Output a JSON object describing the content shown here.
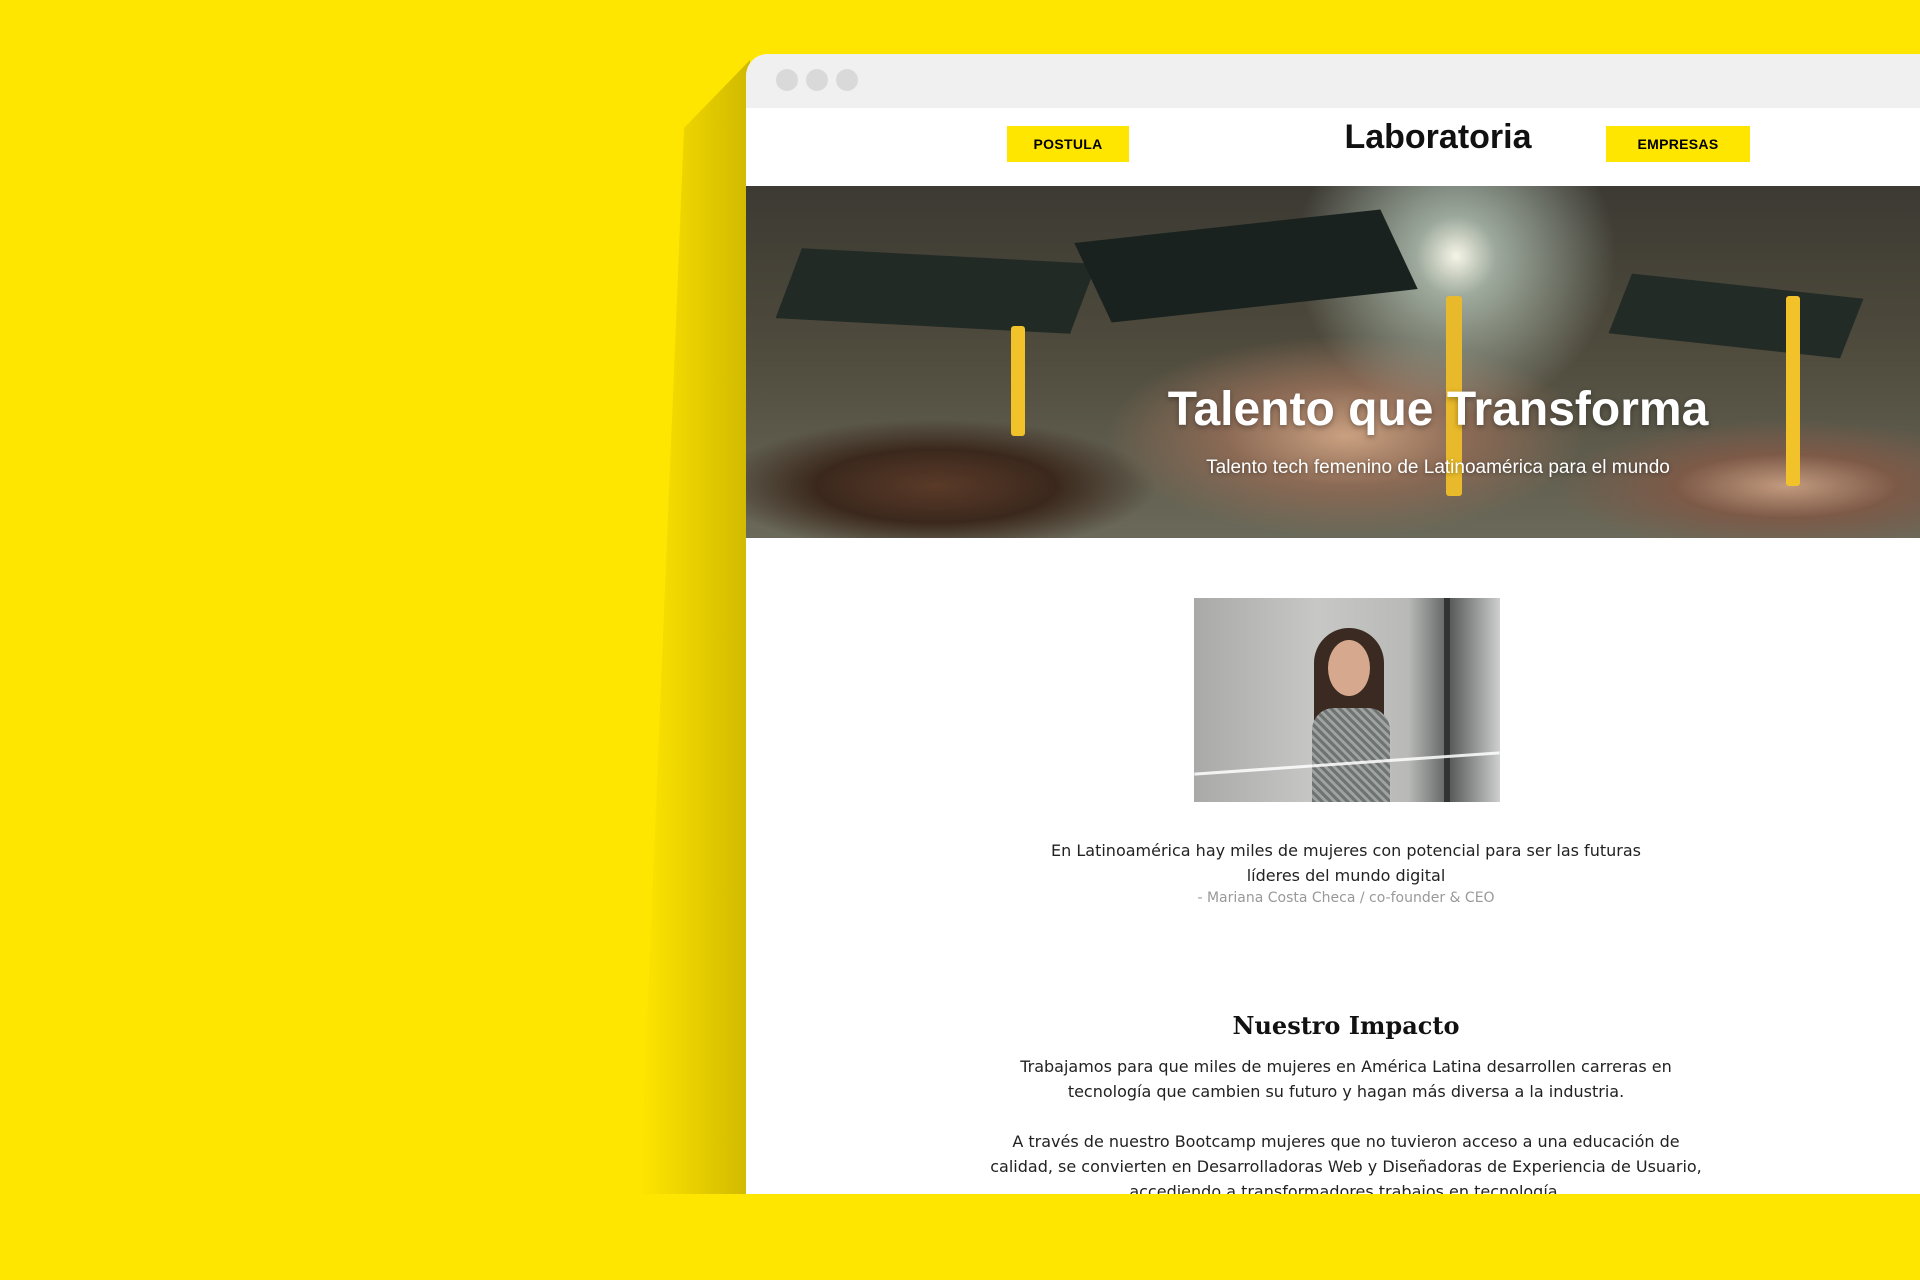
{
  "nav": {
    "left_button": "POSTULA",
    "logo": "Laboratoria",
    "right_button": "EMPRESAS"
  },
  "hero": {
    "title": "Talento que Transforma",
    "subtitle": "Talento tech femenino de Latinoamérica para el mundo"
  },
  "quote": {
    "text": "En Latinoamérica hay miles de mujeres con potencial para ser las futuras líderes del mundo digital",
    "author": "- Mariana Costa Checa / co-founder & CEO"
  },
  "impact": {
    "title": "Nuestro Impacto",
    "paragraph_1": "Trabajamos para que miles de mujeres en América Latina desarrollen carreras en tecnología que cambien su futuro y hagan más diversa a la industria.",
    "paragraph_2": "A través de nuestro Bootcamp mujeres que no tuvieron acceso a una educación de calidad, se convierten en Desarrolladoras Web y Diseñadoras de Experiencia de Usuario, accediendo a transformadores trabajos en tecnología."
  },
  "colors": {
    "brand_yellow": "#ffe600",
    "window_bg": "#ffffff",
    "titlebar_bg": "#f0f0f0"
  }
}
